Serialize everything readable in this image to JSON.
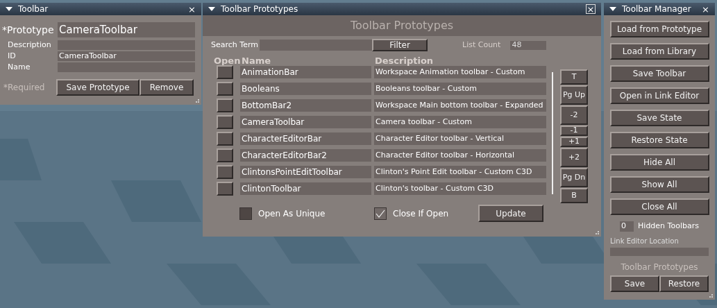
{
  "toolbar_panel": {
    "title": "Toolbar",
    "close": "×",
    "fields": [
      {
        "kind": "primary",
        "label": "*Prototype",
        "value": "CameraToolbar"
      },
      {
        "kind": "secondary",
        "label": "Description"
      },
      {
        "kind": "secondary",
        "label": "ID",
        "value": "CameraToolbar"
      },
      {
        "kind": "secondary",
        "label": "Name"
      }
    ],
    "required_note": "*Required",
    "buttons": [
      "Save Prototype",
      "Remove"
    ]
  },
  "prototypes_panel": {
    "title": "Toolbar Prototypes",
    "close": "×",
    "heading": "Toolbar Prototypes",
    "search_label": "Search Term",
    "filter_button": "Filter",
    "list_count_label": "List Count",
    "list_count": "48",
    "columns": [
      "Open",
      "Name",
      "Description"
    ],
    "rows": [
      {
        "open": false,
        "name": "AnimationBar",
        "description": "Workspace Animation toolbar - Custom"
      },
      {
        "open": false,
        "name": "Booleans",
        "description": "Booleans toolbar - Custom"
      },
      {
        "open": false,
        "name": "BottomBar2",
        "description": "Workspace Main bottom toolbar - Expanded"
      },
      {
        "open": false,
        "name": "CameraToolbar",
        "description": "Camera toolbar - Custom"
      },
      {
        "open": false,
        "name": "CharacterEditorBar",
        "description": "Character Editor toolbar - Vertical"
      },
      {
        "open": false,
        "name": "CharacterEditorBar2",
        "description": "Character Editor toolbar - Horizontal"
      },
      {
        "open": false,
        "name": "ClintonsPointEditToolbar",
        "description": "Clinton's Point Edit toolbar - Custom C3D"
      },
      {
        "open": false,
        "name": "ClintonToolbar",
        "description": "Clinton's toolbar - Custom C3D"
      }
    ],
    "scroll_buttons": [
      {
        "label": "T",
        "kind": "end"
      },
      {
        "label": "Pg Up",
        "kind": "page"
      },
      {
        "label": "-2",
        "kind": "page"
      },
      {
        "label": "-1",
        "kind": "step"
      },
      {
        "label": "+1",
        "kind": "step"
      },
      {
        "label": "+2",
        "kind": "page"
      },
      {
        "label": "Pg Dn",
        "kind": "page"
      },
      {
        "label": "B",
        "kind": "end"
      }
    ],
    "options": [
      {
        "label": "Open As Unique",
        "checked": false
      },
      {
        "label": "Close If Open",
        "checked": true
      }
    ],
    "update_button": "Update"
  },
  "manager_panel": {
    "title": "Toolbar Manager",
    "close": "×",
    "buttons": [
      "Load from Prototype",
      "Load from Library",
      "Save Toolbar",
      "Open in Link Editor",
      "Save State",
      "Restore State",
      "Hide All",
      "Show All",
      "Close All"
    ],
    "hidden_count": "0",
    "hidden_label": "Hidden Toolbars",
    "link_editor_label": "Link Editor Location",
    "prototypes_label": "Toolbar Prototypes",
    "bottom_buttons": [
      "Save",
      "Restore"
    ]
  }
}
